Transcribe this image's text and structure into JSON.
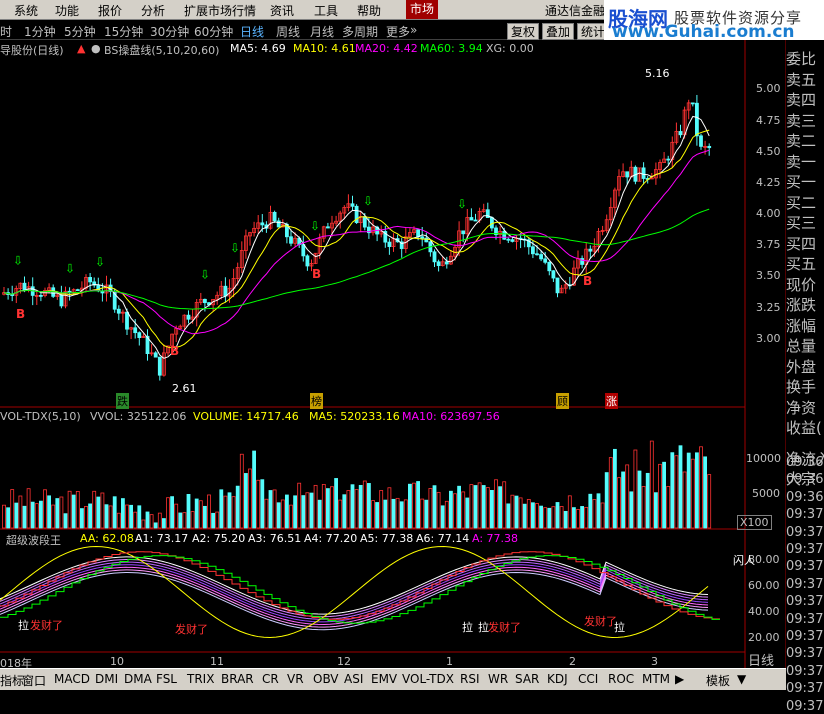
{
  "menu": {
    "items": [
      "系统",
      "功能",
      "报价",
      "分析",
      "扩展市场行情",
      "资讯",
      "工具",
      "帮助"
    ],
    "market_tab": "市场",
    "app_name": "通达信金融"
  },
  "watermark": {
    "logo": "股海网",
    "sub": "股票软件资源分享",
    "url": "www.Guhai.com.cn"
  },
  "periods": {
    "items": [
      "时",
      "1分钟",
      "5分钟",
      "15分钟",
      "30分钟",
      "60分钟",
      "日线",
      "周线",
      "月线",
      "多周期",
      "更多"
    ],
    "selected": "日线",
    "buttons": [
      "复权",
      "叠加",
      "统计"
    ]
  },
  "main_chart": {
    "stock_label": "导股份(日线)",
    "indicator": "BS操盘线(5,10,20,60)",
    "ma5": "MA5: 4.69",
    "ma10": "MA10: 4.61",
    "ma20": "MA20: 4.42",
    "ma60": "MA60: 3.94",
    "xg": "XG: 0.00",
    "price_axis": [
      "5.00",
      "4.75",
      "4.50",
      "4.25",
      "4.00",
      "3.75",
      "3.50",
      "3.25",
      "3.00"
    ],
    "high_label": "5.16",
    "low_label": "2.61",
    "signals": [
      "跌",
      "榜",
      "顾",
      "涨"
    ],
    "b_marker": "B"
  },
  "volume_chart": {
    "title": "VOL-TDX(5,10)",
    "vvol": "VVOL: 325122.06",
    "volume": "VOLUME: 14717.46",
    "ma5": "MA5: 520233.16",
    "ma10": "MA10: 623697.56",
    "axis": [
      "10000",
      "5000"
    ],
    "unit": "X100"
  },
  "osc_chart": {
    "title": "超级波段王",
    "aa": "AA: 62.08",
    "a1": "A1: 73.17",
    "a2": "A2: 75.20",
    "a3": "A3: 76.51",
    "a4": "A4: 77.20",
    "a5": "A5: 77.38",
    "a6": "A6: 77.14",
    "a7": "A: 77.38",
    "axis": [
      "80.00",
      "60.00",
      "40.00",
      "20.00"
    ],
    "labels": [
      "拉",
      "发财了",
      "发财了",
      "拉",
      "拉",
      "发财了",
      "发财了",
      "拉"
    ],
    "side_label": "闪人"
  },
  "date_axis": [
    "018年",
    "10",
    "11",
    "12",
    "1",
    "2",
    "3"
  ],
  "tabs": [
    "指标",
    "窗口",
    "MACD",
    "DMI",
    "DMA",
    "FSL",
    "TRIX",
    "BRAR",
    "CR",
    "VR",
    "OBV",
    "ASI",
    "EMV",
    "VOL-TDX",
    "RSI",
    "WR",
    "SAR",
    "KDJ",
    "CCI",
    "ROC",
    "MTM"
  ],
  "tab_template": "模板",
  "side": {
    "order_book": [
      "委比",
      "卖五",
      "卖四",
      "卖三",
      "卖二",
      "卖一",
      "买一",
      "买二",
      "买三",
      "买四",
      "买五",
      "现价",
      "涨跌",
      "涨幅",
      "总量",
      "外盘",
      "换手",
      "净资",
      "收益(",
      "净流入",
      "大宗"
    ],
    "times": [
      "09:36",
      "09:36",
      "09:36",
      "09:37",
      "09:37",
      "09:37",
      "09:37",
      "09:37",
      "09:37",
      "09:37",
      "09:37",
      "09:37",
      "09:37",
      "09:37",
      "09:37"
    ],
    "period": "日线"
  },
  "colors": {
    "up": "#ff3232",
    "down": "#54fcfc",
    "ma5": "#ffffff",
    "ma10": "#ffff00",
    "ma20": "#ff00ff",
    "ma60": "#00ff00",
    "accent": "#a00000"
  }
}
